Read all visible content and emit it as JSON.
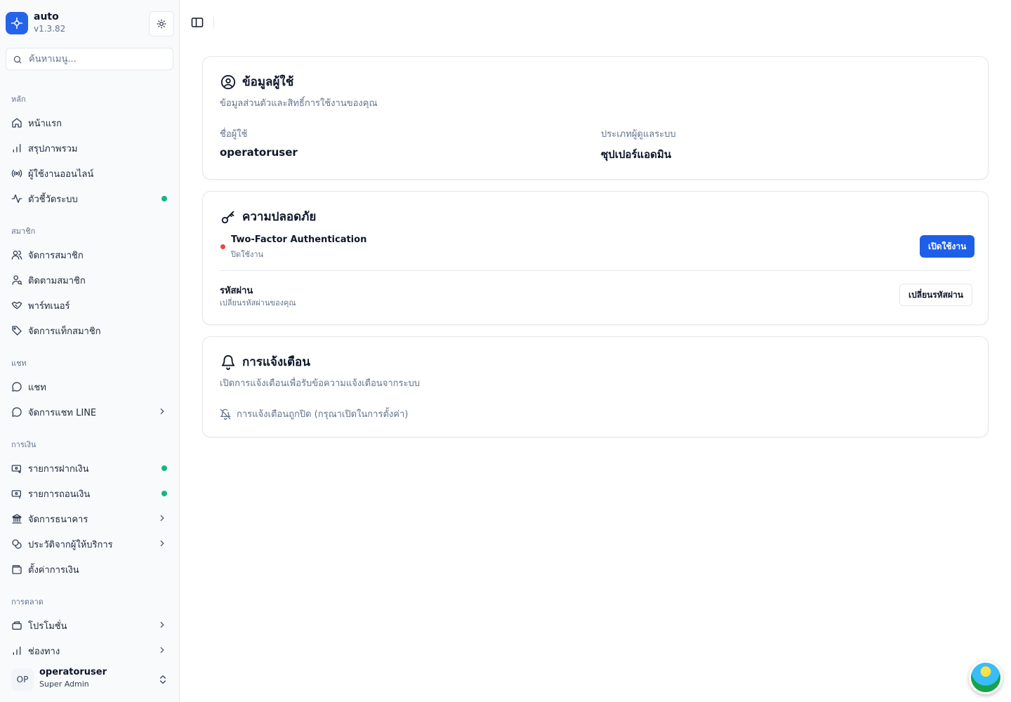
{
  "brand": {
    "name": "auto",
    "version": "v1.3.82"
  },
  "search": {
    "placeholder": "ค้นหาเมนู..."
  },
  "nav": {
    "groups": [
      {
        "label": "หลัก",
        "items": [
          {
            "label": "หน้าแรก",
            "icon": "home-icon"
          },
          {
            "label": "สรุปภาพรวม",
            "icon": "bar-chart-icon"
          },
          {
            "label": "ผู้ใช้งานออนไลน์",
            "icon": "radio-icon"
          },
          {
            "label": "ตัวชี้วัดระบบ",
            "icon": "activity-icon",
            "indicator": "green"
          }
        ]
      },
      {
        "label": "สมาชิก",
        "items": [
          {
            "label": "จัดการสมาชิก",
            "icon": "users-icon"
          },
          {
            "label": "ติดตามสมาชิก",
            "icon": "user-search-icon"
          },
          {
            "label": "พาร์ทเนอร์",
            "icon": "handshake-icon"
          },
          {
            "label": "จัดการแท็กสมาชิก",
            "icon": "tag-icon"
          }
        ]
      },
      {
        "label": "แชท",
        "items": [
          {
            "label": "แชท",
            "icon": "message-circle-icon"
          },
          {
            "label": "จัดการแชท LINE",
            "icon": "message-circle-icon",
            "chevron": true
          }
        ]
      },
      {
        "label": "การเงิน",
        "items": [
          {
            "label": "รายการฝากเงิน",
            "icon": "wallet-in-icon",
            "indicator": "green"
          },
          {
            "label": "รายการถอนเงิน",
            "icon": "wallet-out-icon",
            "indicator": "green"
          },
          {
            "label": "จัดการธนาคาร",
            "icon": "bank-icon",
            "chevron": true
          },
          {
            "label": "ประวัติจากผู้ให้บริการ",
            "icon": "coins-icon",
            "chevron": true
          },
          {
            "label": "ตั้งค่าการเงิน",
            "icon": "wallet-icon"
          }
        ]
      },
      {
        "label": "การตลาด",
        "items": [
          {
            "label": "โปรโมชั่น",
            "icon": "ticket-icon",
            "chevron": true
          },
          {
            "label": "ช่องทาง",
            "icon": "bar-chart-icon",
            "chevron": true
          }
        ]
      }
    ]
  },
  "user": {
    "initials": "OP",
    "name": "operatoruser",
    "role": "Super Admin"
  },
  "profile_card": {
    "title": "ข้อมูลผู้ใช้",
    "description": "ข้อมูลส่วนตัวและสิทธิ์การใช้งานของคุณ",
    "username_label": "ชื่อผู้ใช้",
    "username_value": "operatoruser",
    "type_label": "ประเภทผู้ดูแลระบบ",
    "type_value": "ซุปเปอร์แอดมิน"
  },
  "security_card": {
    "title": "ความปลอดภัย",
    "twofa_title": "Two-Factor Authentication",
    "twofa_status": "ปิดใช้งาน",
    "twofa_button": "เปิดใช้งาน",
    "password_title": "รหัสผ่าน",
    "password_sub": "เปลี่ยนรหัสผ่านของคุณ",
    "password_button": "เปลี่ยนรหัสผ่าน"
  },
  "notification_card": {
    "title": "การแจ้งเตือน",
    "description": "เปิดการแจ้งเตือนเพื่อรับข้อความแจ้งเตือนจากระบบ",
    "status_text": "การแจ้งเตือนถูกปิด (กรุณาเปิดในการตั้งค่า)"
  },
  "colors": {
    "accent": "#1d5fe8",
    "online": "#10b981",
    "danger": "#ef4444"
  }
}
